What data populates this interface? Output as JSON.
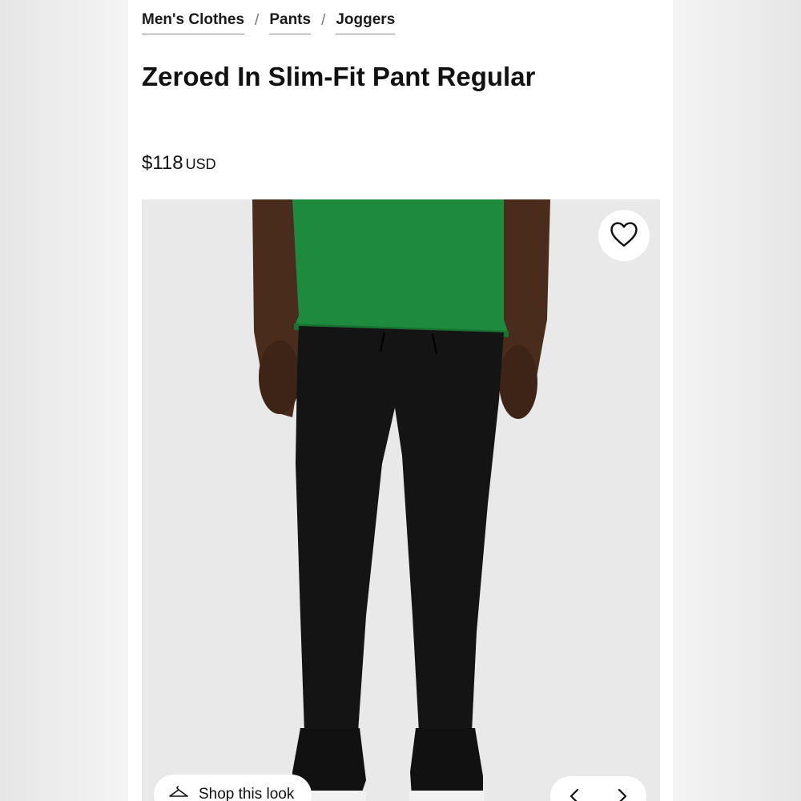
{
  "breadcrumb": {
    "items": [
      "Men's Clothes",
      "Pants",
      "Joggers"
    ],
    "separator": "/"
  },
  "product": {
    "title": "Zeroed In Slim-Fit Pant Regular",
    "price": "$118",
    "currency": "USD"
  },
  "gallery": {
    "shop_look_label": "Shop this look",
    "icons": {
      "favorite": "heart-icon",
      "shop_look": "hanger-icon",
      "previous": "chevron-left-icon",
      "next": "chevron-right-icon"
    }
  },
  "colors": {
    "shirt": "#1e8a3e",
    "pants": "#141414",
    "background": "#e9e9e9"
  }
}
